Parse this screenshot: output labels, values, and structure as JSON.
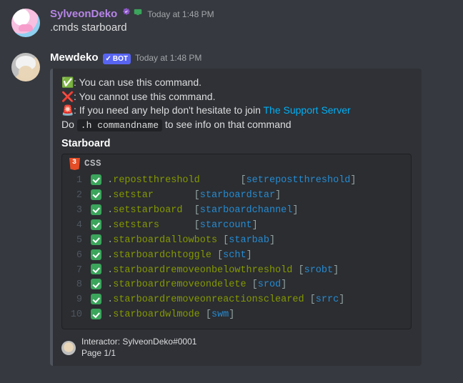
{
  "messages": {
    "user": {
      "name": "SylveonDeko",
      "timestamp": "Today at 1:48 PM",
      "content": ".cmds starboard"
    },
    "bot": {
      "name": "Mewdeko",
      "bot_tag": "BOT",
      "timestamp": "Today at 1:48 PM"
    }
  },
  "embed": {
    "can_use": ": You can use this command.",
    "cannot_use": ": You cannot use this command.",
    "help_prefix": ": If you need any help don't hesitate to join ",
    "support_link": "The Support Server",
    "do_prefix": "Do ",
    "do_code": ".h commandname",
    "do_suffix": " to see info on that command",
    "section_title": "Starboard",
    "lang_label": "CSS",
    "commands": [
      {
        "n": "1",
        "name": "repostthreshold",
        "pad": "       ",
        "alias": "setrepostthreshold"
      },
      {
        "n": "2",
        "name": "setstar",
        "pad": "       ",
        "alias": "starboardstar"
      },
      {
        "n": "3",
        "name": "setstarboard",
        "pad": "  ",
        "alias": "starboardchannel"
      },
      {
        "n": "4",
        "name": "setstars",
        "pad": "      ",
        "alias": "starcount"
      },
      {
        "n": "5",
        "name": "starboardallowbots",
        "pad": " ",
        "alias": "starbab"
      },
      {
        "n": "6",
        "name": "starboardchtoggle",
        "pad": " ",
        "alias": "scht"
      },
      {
        "n": "7",
        "name": "starboardremoveonbelowthreshold",
        "pad": " ",
        "alias": "srobt"
      },
      {
        "n": "8",
        "name": "starboardremoveondelete",
        "pad": " ",
        "alias": "srod"
      },
      {
        "n": "9",
        "name": "starboardremoveonreactionscleared",
        "pad": " ",
        "alias": "srrc"
      },
      {
        "n": "10",
        "name": "starboardwlmode",
        "pad": " ",
        "alias": "swm"
      }
    ],
    "footer_line1": "Interactor: SylveonDeko#0001",
    "footer_line2": "Page 1/1"
  }
}
